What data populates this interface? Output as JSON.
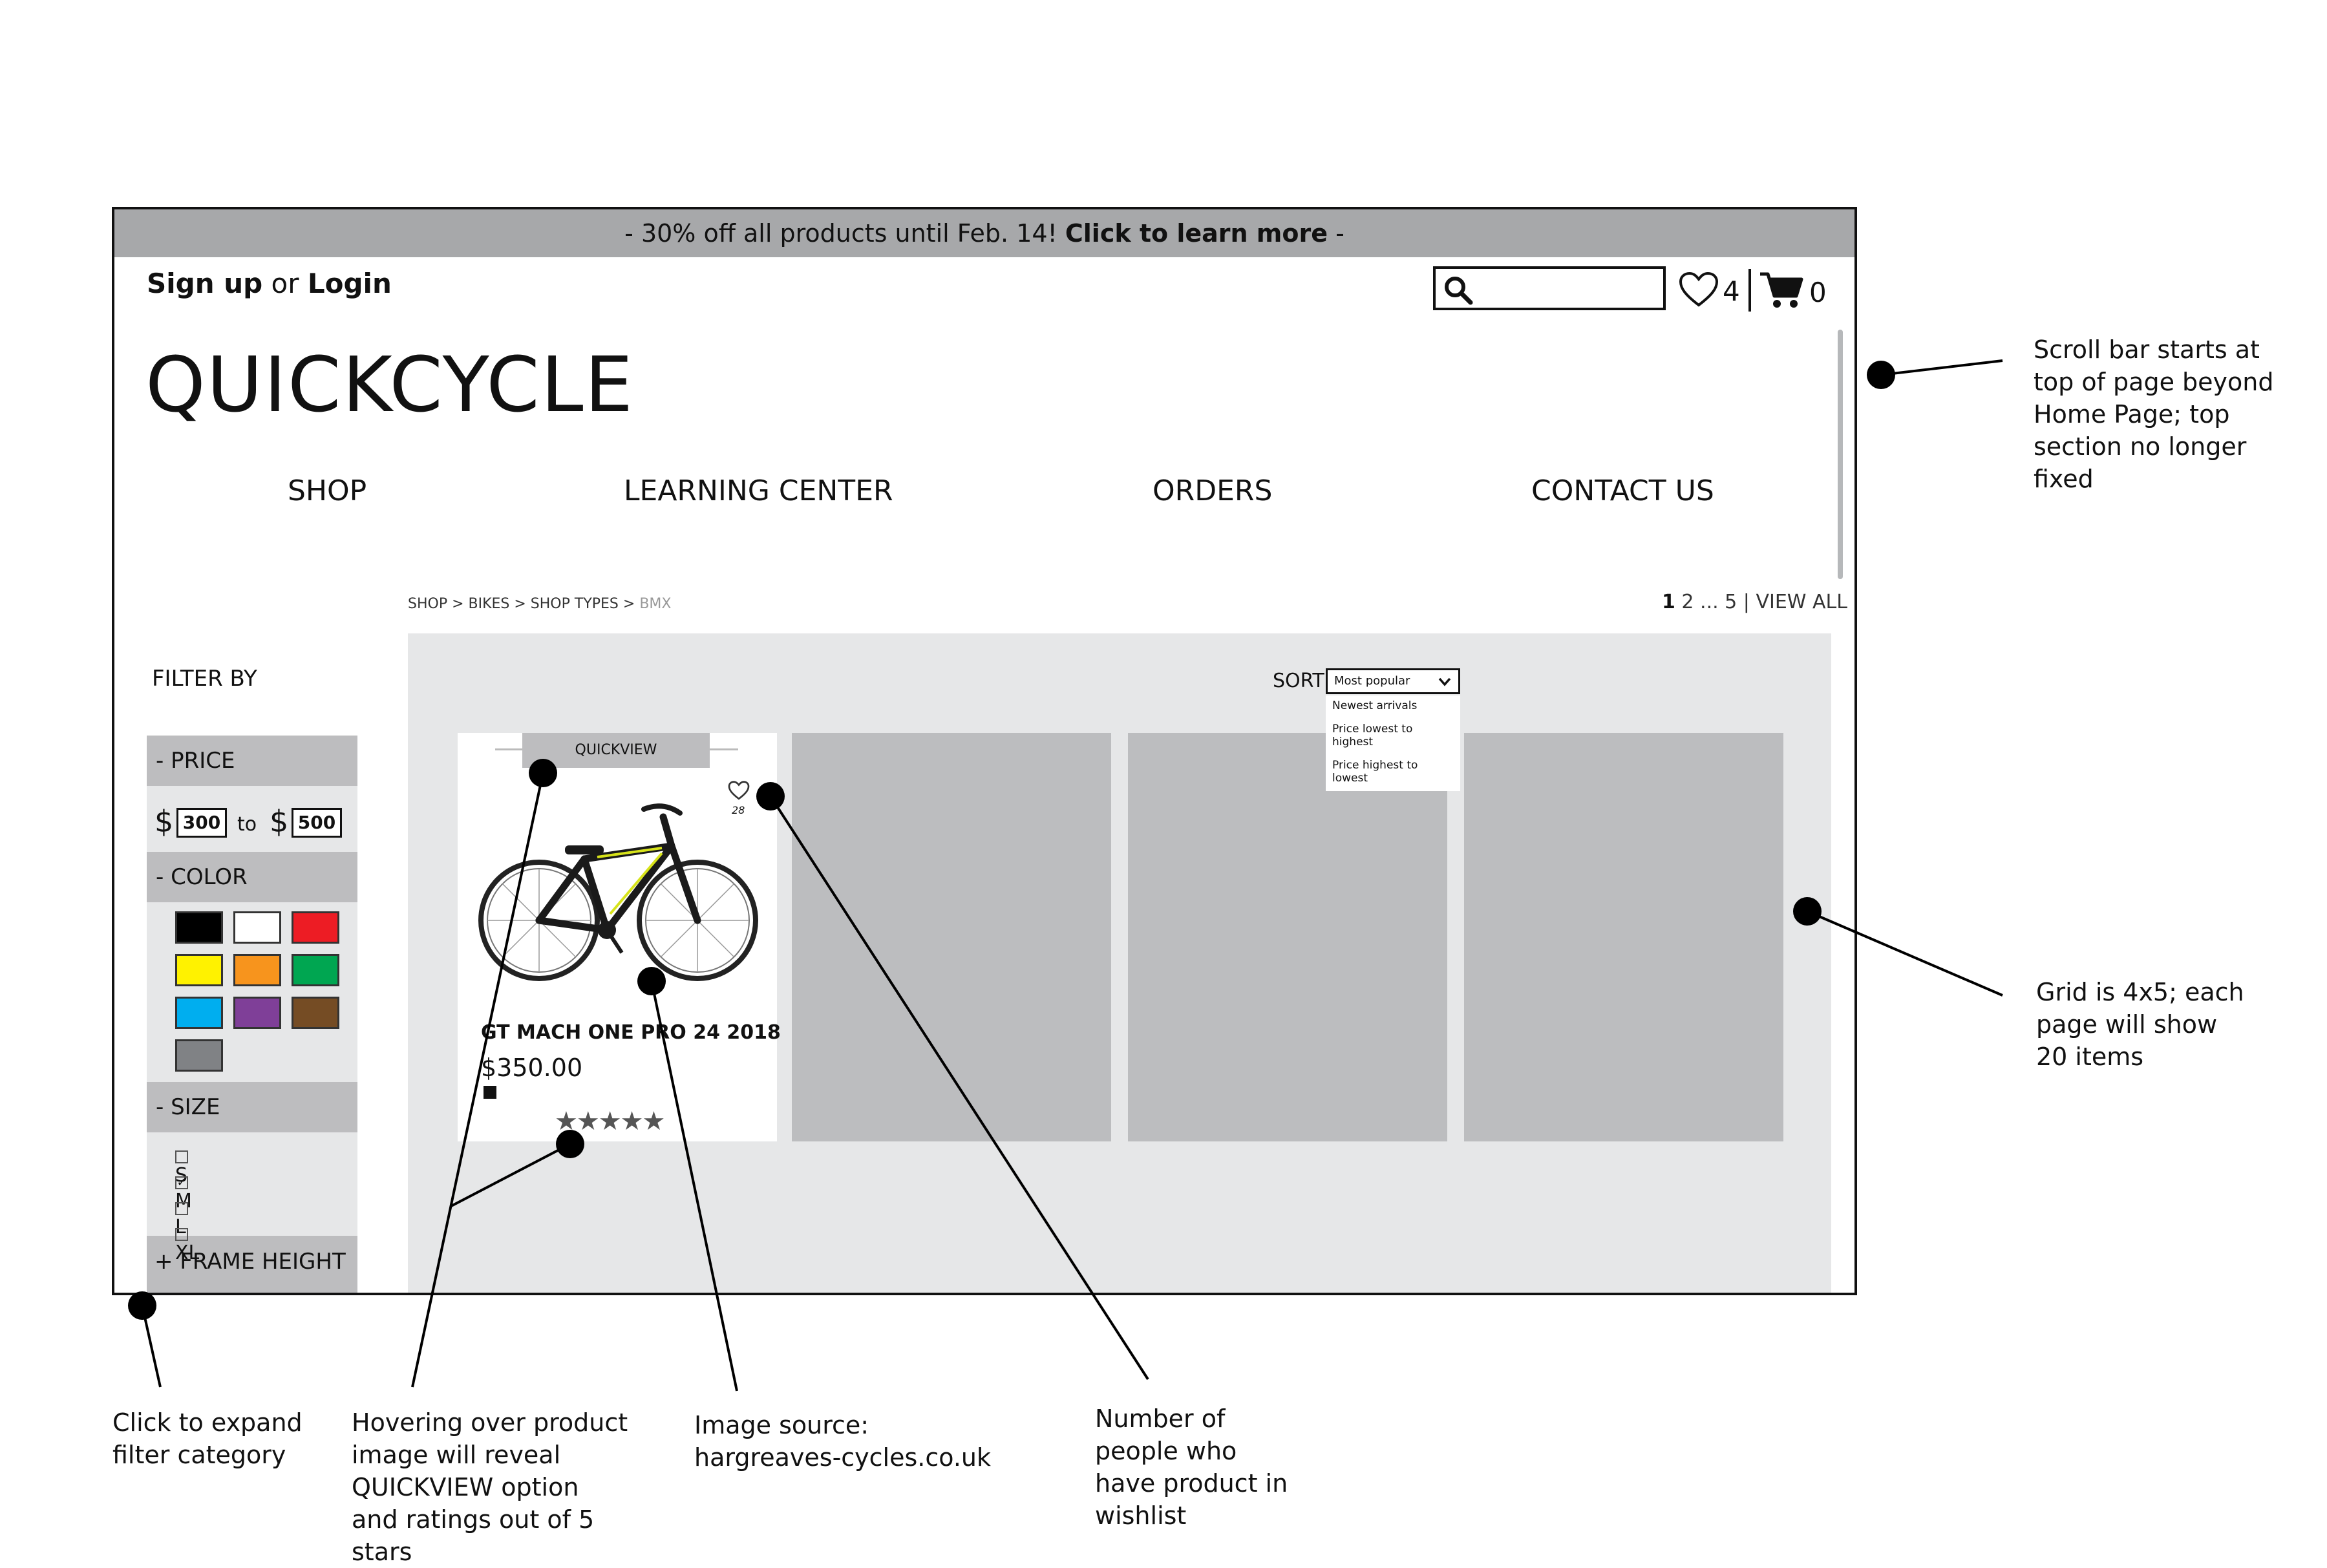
{
  "promo": {
    "text": "- 30% off all products until Feb. 14! ",
    "link": "Click to learn more",
    "tail": " -"
  },
  "auth": {
    "signup": "Sign up",
    "or": " or ",
    "login": "Login"
  },
  "header": {
    "wishlist_count": "4",
    "cart_count": "0"
  },
  "logo": "QUICKCYCLE",
  "nav": [
    "SHOP",
    "LEARNING CENTER",
    "ORDERS",
    "CONTACT US"
  ],
  "breadcrumb": {
    "path": "SHOP > BIKES > SHOP TYPES > ",
    "current": "BMX"
  },
  "pagination": {
    "current": "1",
    "rest": " 2 ... 5 | VIEW ALL"
  },
  "filter": {
    "title": "FILTER BY",
    "price": {
      "label": "- PRICE",
      "currency": "$",
      "min": "300",
      "to": "to",
      "max": "500"
    },
    "color": {
      "label": "- COLOR",
      "swatches": [
        "#000000",
        "#ffffff",
        "#ed1c24",
        "#fff200",
        "#f7941d",
        "#00a651",
        "#00aeef",
        "#7f3f98",
        "#754c24",
        "#808285"
      ]
    },
    "size": {
      "label": "- SIZE",
      "options": [
        {
          "label": "S",
          "checked": false
        },
        {
          "label": "M",
          "checked": true
        },
        {
          "label": "L",
          "checked": false
        },
        {
          "label": "XL",
          "checked": false
        }
      ]
    },
    "frame": {
      "label": "+ FRAME HEIGHT"
    }
  },
  "sort": {
    "label": "SORT BY",
    "selected": "Most popular",
    "options": [
      "Newest arrivals",
      "Price lowest to highest",
      "Price highest to lowest"
    ]
  },
  "product": {
    "quickview": "QUICKVIEW",
    "name": "GT MACH ONE PRO 24 2018",
    "price": "$350.00",
    "wishlist_count": "28",
    "rating": 5
  },
  "annotations": {
    "scroll": "Scroll bar starts at top of page beyond Home Page; top section no longer fixed",
    "grid": "Grid is 4x5; each page will show 20 items",
    "expand": "Click to expand filter category",
    "hover": "Hovering over product image will reveal QUICKVIEW option and ratings out of 5 stars",
    "image": "Image source: hargreaves-cycles.co.uk",
    "wishlist": "Number of people who have product in wishlist"
  }
}
